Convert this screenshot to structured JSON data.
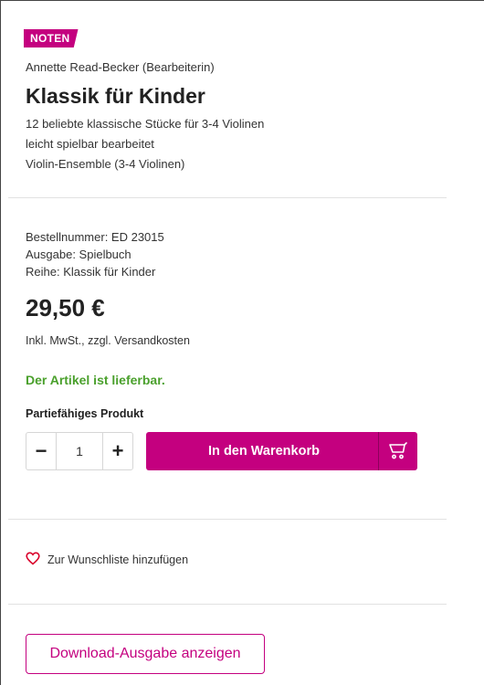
{
  "product": {
    "badge": "NOTEN",
    "author": "Annette Read-Becker (Bearbeiterin)",
    "title": "Klassik für Kinder",
    "subtitle_lines": [
      "12 beliebte klassische Stücke für 3-4 Violinen",
      "leicht spielbar bearbeitet",
      "Violin-Ensemble (3-4 Violinen)"
    ]
  },
  "details": {
    "order_number": "Bestellnummer: ED 23015",
    "edition": "Ausgabe: Spielbuch",
    "series": "Reihe: Klassik für Kinder"
  },
  "pricing": {
    "price": "29,50 €",
    "tax_note": "Inkl. MwSt., zzgl. Versandkosten",
    "availability": "Der Artikel ist lieferbar."
  },
  "purchase": {
    "partie_label": "Partiefähiges Produkt",
    "quantity": "1",
    "minus_label": "−",
    "plus_label": "+",
    "cart_label": "In den Warenkorb",
    "cart_icon": "cart-icon"
  },
  "wishlist": {
    "label": "Zur Wunschliste hinzufügen",
    "icon": "heart-icon"
  },
  "download": {
    "label": "Download-Ausgabe anzeigen"
  },
  "colors": {
    "accent": "#c4007f",
    "available": "#4aa02c"
  }
}
